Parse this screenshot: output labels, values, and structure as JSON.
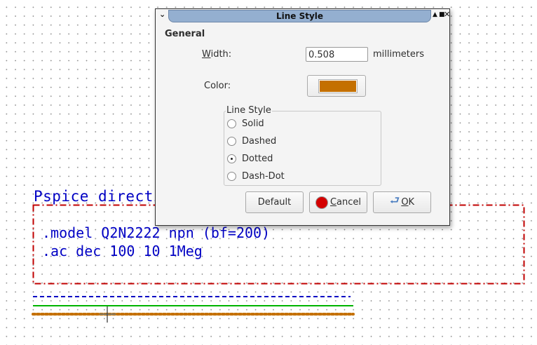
{
  "canvas": {
    "directive_title": "Pspice directive",
    "directive_lines": [
      ".model Q2N2222 npn (bf=200)",
      ".ac dec 100 10 1Meg"
    ],
    "colors": {
      "text": "#0000c4",
      "box": "#c00000",
      "blue_dashed": "#0000c4",
      "green": "#00b400",
      "orange": "#c47000"
    }
  },
  "dialog": {
    "title": "Line Style",
    "section": "General",
    "width_label_accel": "W",
    "width_label_rest": "idth:",
    "width_value": "0.508",
    "width_unit": "millimeters",
    "color_label": "Color:",
    "color_value": "#c47000",
    "group_title": "Line Style",
    "options": [
      {
        "label": "Solid",
        "checked": false
      },
      {
        "label": "Dashed",
        "checked": false
      },
      {
        "label": "Dotted",
        "checked": true
      },
      {
        "label": "Dash-Dot",
        "checked": false
      }
    ],
    "buttons": {
      "default": "Default",
      "cancel_accel": "C",
      "cancel_rest": "ancel",
      "ok_accel": "O",
      "ok_rest": "K"
    }
  }
}
